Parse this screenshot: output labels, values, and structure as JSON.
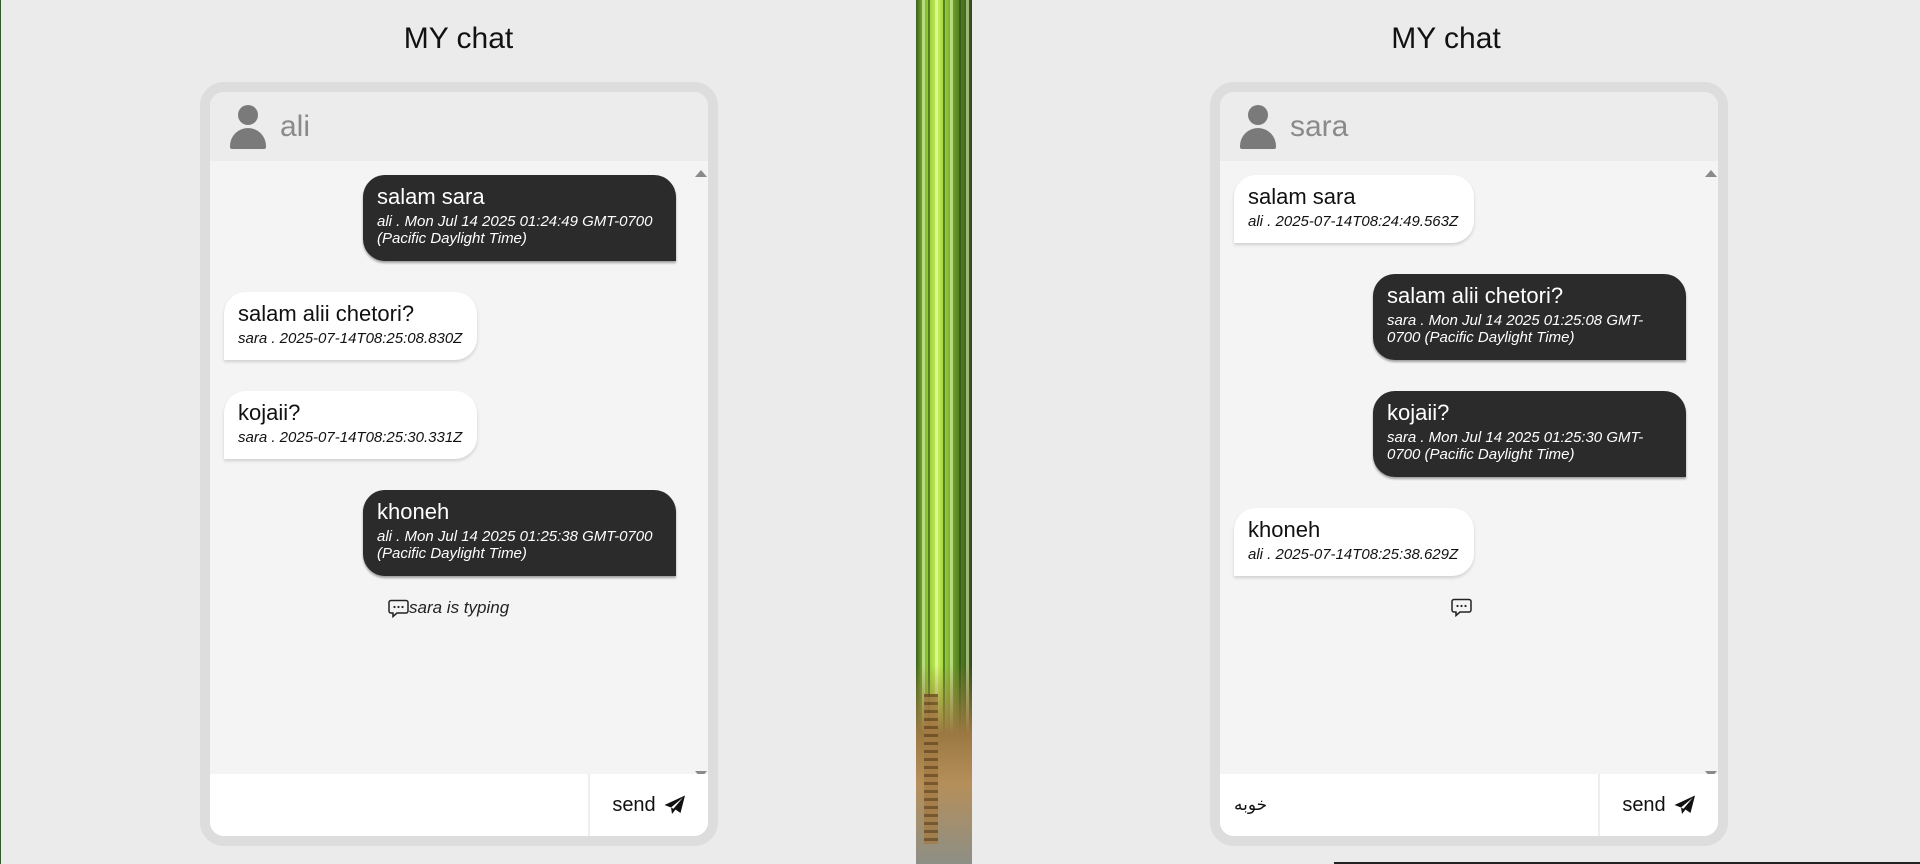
{
  "left": {
    "title": "MY chat",
    "contact": "ali",
    "messages": [
      {
        "text": "salam sara",
        "meta": "ali . Mon Jul 14 2025 01:24:49 GMT-0700 (Pacific Daylight Time)"
      },
      {
        "text": "salam alii chetori?",
        "meta": "sara . 2025-07-14T08:25:08.830Z"
      },
      {
        "text": "kojaii?",
        "meta": "sara . 2025-07-14T08:25:30.331Z"
      },
      {
        "text": "khoneh",
        "meta": "ali . Mon Jul 14 2025 01:25:38 GMT-0700 (Pacific Daylight Time)"
      }
    ],
    "typing": "sara is typing",
    "input_value": "",
    "send_label": "send"
  },
  "right": {
    "title": "MY chat",
    "contact": "sara",
    "messages": [
      {
        "text": "salam sara",
        "meta": "ali . 2025-07-14T08:24:49.563Z"
      },
      {
        "text": "salam alii chetori?",
        "meta": "sara . Mon Jul 14 2025 01:25:08 GMT-0700 (Pacific Daylight Time)"
      },
      {
        "text": "kojaii?",
        "meta": "sara . Mon Jul 14 2025 01:25:30 GMT-0700 (Pacific Daylight Time)"
      },
      {
        "text": "khoneh",
        "meta": "ali . 2025-07-14T08:25:38.629Z"
      }
    ],
    "typing": "",
    "input_value": "خوبه",
    "send_label": "send"
  },
  "icons": {
    "avatar": "user-icon",
    "typing": "chat-bubble-icon",
    "send": "paper-plane-icon"
  },
  "colors": {
    "own_bubble": "#2b2b2b",
    "other_bubble": "#ffffff",
    "background": "#ebebeb"
  }
}
